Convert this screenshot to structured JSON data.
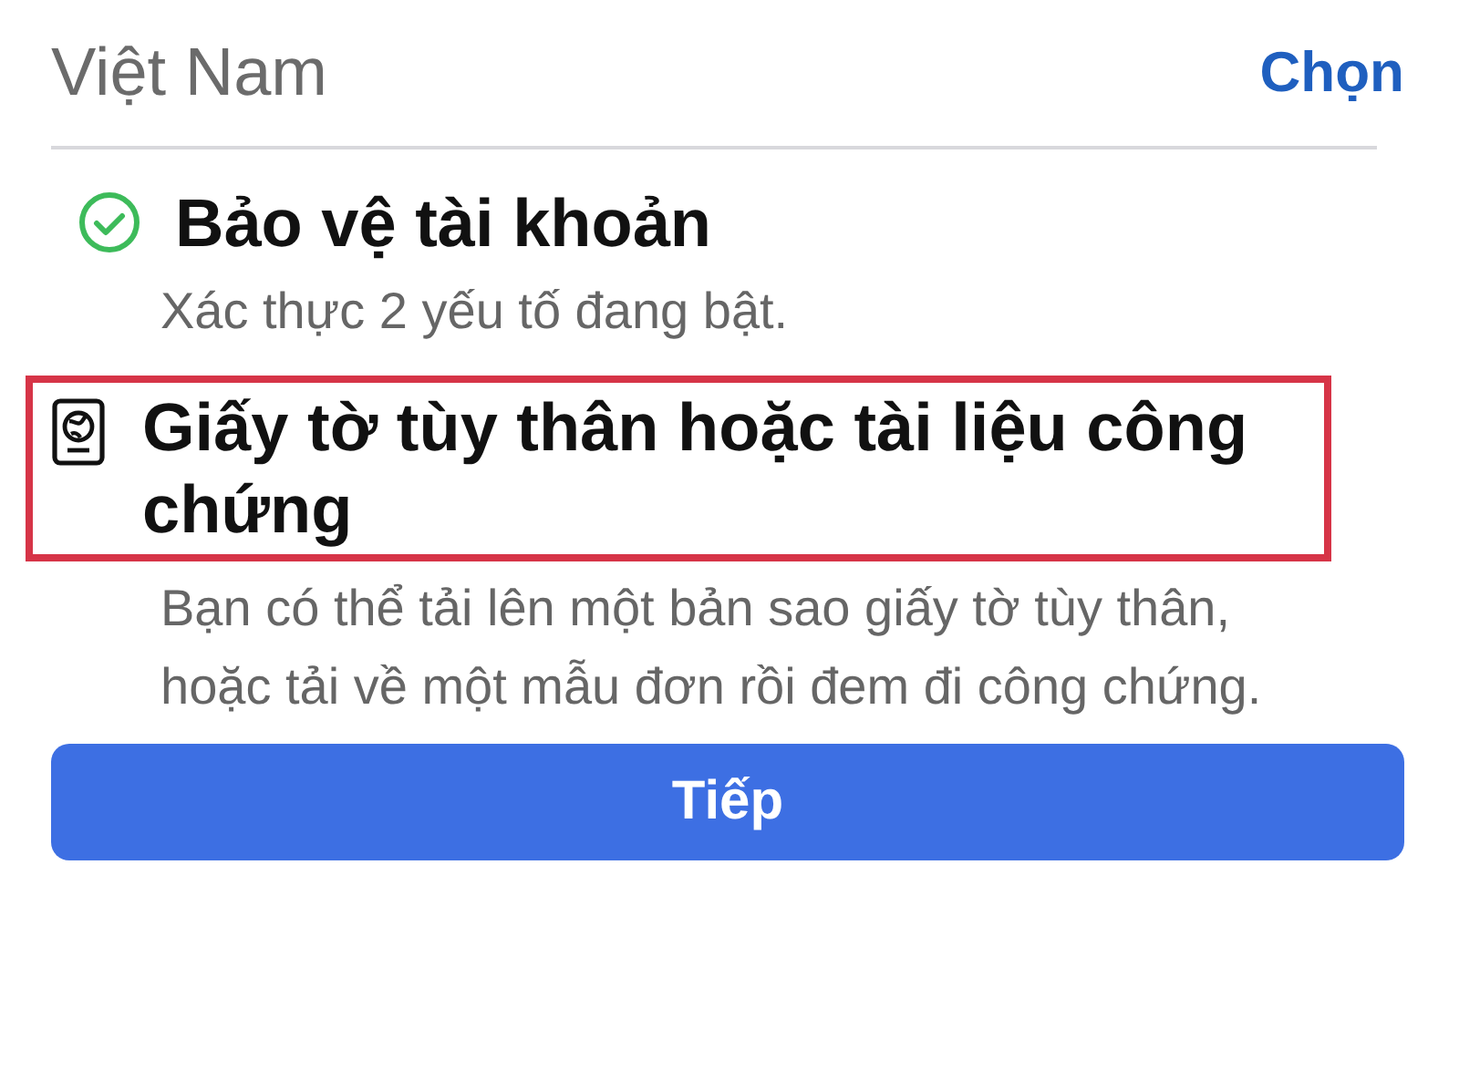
{
  "country": {
    "name": "Việt Nam",
    "action": "Chọn"
  },
  "options": [
    {
      "kind": "check",
      "title": "Bảo vệ tài khoản",
      "description": "Xác thực 2 yếu tố đang bật.",
      "highlighted": false
    },
    {
      "kind": "document",
      "title": "Giấy tờ tùy thân hoặc tài liệu công chứng",
      "description": "Bạn có thể tải lên một bản sao giấy tờ tùy thân, hoặc tải về một mẫu đơn rồi đem đi công chứng.",
      "highlighted": true
    }
  ],
  "button": "Tiếp"
}
